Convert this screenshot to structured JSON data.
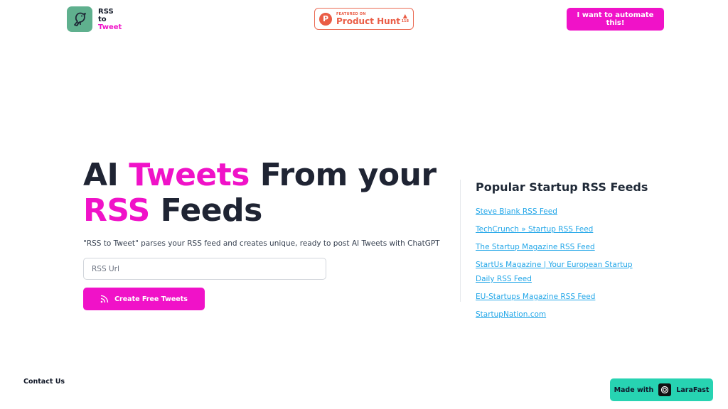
{
  "header": {
    "logo": {
      "line1": "RSS",
      "line2": "to",
      "line3": "Tweet"
    },
    "product_hunt": {
      "featured": "FEATURED ON",
      "name": "Product Hunt",
      "votes": "118"
    },
    "cta_label": "I want to automate this!"
  },
  "hero": {
    "title_part1": "AI ",
    "title_highlight1": "Tweets",
    "title_part2": " From your",
    "title_highlight2": "RSS",
    "title_part3": " Feeds",
    "description": "\"RSS to Tweet\" parses your RSS feed and creates unique, ready to post AI Tweets with ChatGPT",
    "input_placeholder": "RSS Url",
    "button_label": "Create Free Tweets"
  },
  "popular_feeds": {
    "title": "Popular Startup RSS Feeds",
    "items": [
      {
        "label": "Steve Blank RSS Feed"
      },
      {
        "label": "TechCrunch » Startup RSS Feed"
      },
      {
        "label": "The Startup Magazine RSS Feed"
      },
      {
        "label": "StartUs Magazine | Your European Startup Daily RSS Feed"
      },
      {
        "label": "EU-Startups Magazine RSS Feed"
      },
      {
        "label": "StartupNation.com"
      }
    ]
  },
  "footer": {
    "contact_label": "Contact Us",
    "made_with_label": "Made with",
    "made_with_brand": "LaraFast"
  },
  "colors": {
    "accent": "#f012c8",
    "brand_green": "#5fb08e",
    "link": "#21a6e8",
    "footer_badge": "#27d3b2",
    "product_hunt": "#ea5c45"
  },
  "icons": [
    "bird-logo-icon",
    "product-hunt-icon",
    "upvote-arrow-icon",
    "rss-icon",
    "larafast-icon"
  ]
}
